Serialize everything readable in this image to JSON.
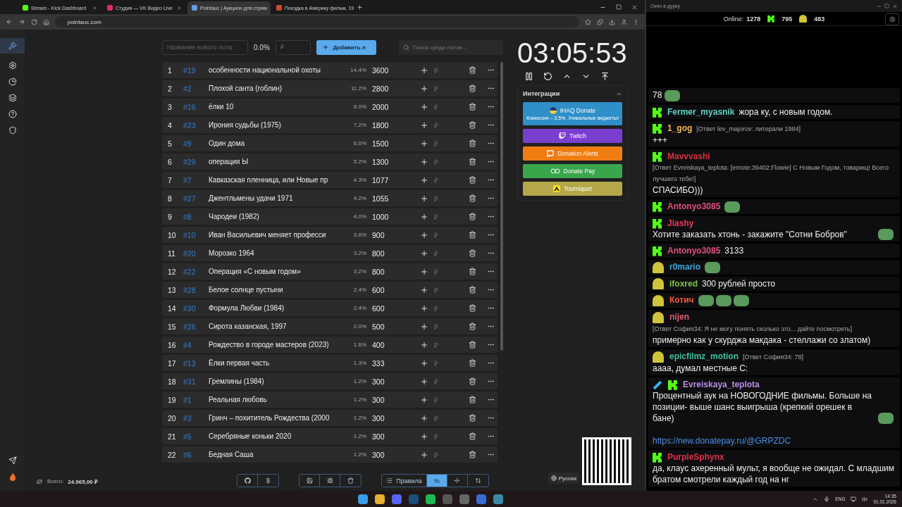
{
  "browser": {
    "tabs": [
      {
        "title": "Stream - Kick Dashboard",
        "selected": false
      },
      {
        "title": "Студия — VK Видео Live",
        "selected": false
      },
      {
        "title": "Pointauc | Аукцион для стрим",
        "selected": true
      },
      {
        "title": "Поездка в Америку фильм, 19",
        "selected": false
      }
    ],
    "url": "pointauc.com"
  },
  "lot_form": {
    "name_placeholder": "Название нового лота",
    "percent": "0.0%",
    "amount_placeholder": "₽",
    "add_button": "Добавить л",
    "search_placeholder": "Поиск среди лотов..."
  },
  "lots": [
    {
      "rank": "1",
      "id": "#19",
      "name": "особенности национальной охоты",
      "percent": "14.4%",
      "amount": "3600",
      "currency": "₽"
    },
    {
      "rank": "2",
      "id": "#2",
      "name": "Плохой санта (гоблин)",
      "percent": "11.2%",
      "amount": "2800",
      "currency": "₽"
    },
    {
      "rank": "3",
      "id": "#16",
      "name": "ёлки 10",
      "percent": "8.0%",
      "amount": "2000",
      "currency": "₽"
    },
    {
      "rank": "4",
      "id": "#23",
      "name": "Ирония судьбы (1975)",
      "percent": "7.2%",
      "amount": "1800",
      "currency": "₽"
    },
    {
      "rank": "5",
      "id": "#9",
      "name": "Один дома",
      "percent": "6.0%",
      "amount": "1500",
      "currency": "₽"
    },
    {
      "rank": "6",
      "id": "#29",
      "name": "операция Ы",
      "percent": "5.2%",
      "amount": "1300",
      "currency": "₽"
    },
    {
      "rank": "7",
      "id": "#7",
      "name": "Кавказская пленница, или Новые пр",
      "percent": "4.3%",
      "amount": "1077",
      "currency": "₽"
    },
    {
      "rank": "8",
      "id": "#27",
      "name": "Джентльмены удачи 1971",
      "percent": "4.2%",
      "amount": "1055",
      "currency": "₽"
    },
    {
      "rank": "9",
      "id": "#8",
      "name": "Чародеи (1982)",
      "percent": "4.0%",
      "amount": "1000",
      "currency": "₽"
    },
    {
      "rank": "10",
      "id": "#10",
      "name": "Иван Васильевич меняет професси",
      "percent": "3.6%",
      "amount": "900",
      "currency": "₽"
    },
    {
      "rank": "11",
      "id": "#20",
      "name": "Морозко 1964",
      "percent": "3.2%",
      "amount": "800",
      "currency": "₽"
    },
    {
      "rank": "12",
      "id": "#22",
      "name": "Операция «С новым годом»",
      "percent": "3.2%",
      "amount": "800",
      "currency": "₽"
    },
    {
      "rank": "13",
      "id": "#28",
      "name": "Белое солнце пустыни",
      "percent": "2.4%",
      "amount": "600",
      "currency": "₽"
    },
    {
      "rank": "14",
      "id": "#30",
      "name": "Формула Любви (1984)",
      "percent": "2.4%",
      "amount": "600",
      "currency": "₽"
    },
    {
      "rank": "15",
      "id": "#26",
      "name": "Сирота казанская, 1997",
      "percent": "2.0%",
      "amount": "500",
      "currency": "₽"
    },
    {
      "rank": "16",
      "id": "#4",
      "name": "Рождество в городе мастеров (2023)",
      "percent": "1.6%",
      "amount": "400",
      "currency": "₽"
    },
    {
      "rank": "17",
      "id": "#13",
      "name": "Ёлки первая часть",
      "percent": "1.3%",
      "amount": "333",
      "currency": "₽"
    },
    {
      "rank": "18",
      "id": "#31",
      "name": "Гремлины (1984)",
      "percent": "1.2%",
      "amount": "300",
      "currency": "₽"
    },
    {
      "rank": "19",
      "id": "#1",
      "name": "Реальная любовь",
      "percent": "1.2%",
      "amount": "300",
      "currency": "₽"
    },
    {
      "rank": "20",
      "id": "#3",
      "name": "Гринч – похититель Рождества (2000",
      "percent": "1.2%",
      "amount": "300",
      "currency": "₽"
    },
    {
      "rank": "21",
      "id": "#5",
      "name": "Серебряные коньки 2020",
      "percent": "1.2%",
      "amount": "300",
      "currency": "₽"
    },
    {
      "rank": "22",
      "id": "#6",
      "name": "Бедная Саша",
      "percent": "1.2%",
      "amount": "300",
      "currency": "₽"
    }
  ],
  "total": {
    "label": "Всего:",
    "value": "24.965,00 ₽"
  },
  "toolbar": [
    [
      {
        "kind": "icon",
        "selected": false
      },
      {
        "kind": "icon",
        "selected": false
      }
    ],
    [
      {
        "kind": "icon",
        "selected": false
      },
      {
        "kind": "icon",
        "selected": false
      },
      {
        "kind": "icon",
        "selected": false
      }
    ],
    [
      {
        "kind": "icon-text",
        "label": "Правила",
        "selected": false
      },
      {
        "kind": "text",
        "label": "%",
        "selected": true
      },
      {
        "kind": "icon",
        "selected": false
      },
      {
        "kind": "icon",
        "selected": false
      }
    ]
  ],
  "timer": "03:05:53",
  "integrations": {
    "title": "Интеграции",
    "expanded": true,
    "items": [
      {
        "kind": "featured",
        "name": "IHAQ Donate",
        "subtitle": "Комиссия – 3,5%. Уникальные виджеты!",
        "color": "#2f8fc8"
      },
      {
        "kind": "twitch",
        "name": "Twitch",
        "color": "#7b3fd0"
      },
      {
        "kind": "donationalerts",
        "name": "Donation Alerts",
        "color": "#f07d12"
      },
      {
        "kind": "donatepay",
        "name": "Donate Pay",
        "color": "#3aa64c"
      },
      {
        "kind": "tourniquet",
        "name": "Tourniquet",
        "color": "#b5a84a"
      }
    ]
  },
  "language": "Русски",
  "chat": {
    "title": "Окно в дурку",
    "online_label": "Online:",
    "online": "1278",
    "kick_count": "795",
    "vk_count": "483",
    "messages": [
      {
        "kind": "plain",
        "moderator": false,
        "text": "78",
        "emotes": [
          {
            "kind": "emote"
          }
        ]
      },
      {
        "kind": "kick",
        "moderator": false,
        "user": "Fermer_myasnik",
        "color": "#5fd3c8",
        "text": "жора ку, с новым годом."
      },
      {
        "kind": "kick",
        "moderator": false,
        "user": "1_gog",
        "color": "#f0b35a",
        "reply": "[Ответ lev_majorov: литерали 1984]",
        "text": "+++"
      },
      {
        "kind": "kick",
        "moderator": false,
        "user": "Mavvvashi",
        "color": "#e0303f",
        "reply": "[Ответ Evreiskaya_teplota: [emote:39402:Flowie] С Новым Годом, товарищ! Всего лучшего тебе!]",
        "text": "СПАСИБО)))"
      },
      {
        "kind": "kick",
        "moderator": false,
        "user": "Antonyo3085",
        "color": "#e0507a",
        "emotes": [
          {
            "kind": "emote"
          }
        ]
      },
      {
        "kind": "kick",
        "moderator": false,
        "user": "Jiashy",
        "color": "#e63d5a",
        "text": "Хотите заказать хтонь - закажите \"Сотни Бобров\"",
        "emotes": [
          {
            "kind": "emote"
          }
        ]
      },
      {
        "kind": "kick",
        "moderator": false,
        "user": "Antonyo3085",
        "color": "#e0507a",
        "text": "3133"
      },
      {
        "kind": "vk",
        "moderator": false,
        "user": "r0mario",
        "color": "#3fa7d6",
        "emotes": [
          {
            "kind": "emote"
          }
        ]
      },
      {
        "kind": "vk",
        "moderator": false,
        "user": "ifoxred",
        "color": "#7bc043",
        "text": "300 рублей просто"
      },
      {
        "kind": "vk",
        "moderator": false,
        "user": "Котич",
        "color": "#f05a3a",
        "emotes": [
          {
            "kind": "emote"
          },
          {
            "kind": "emote"
          },
          {
            "kind": "emote"
          }
        ]
      },
      {
        "kind": "vk",
        "moderator": false,
        "user": "nijen",
        "color": "#e05a70",
        "reply": "[Ответ София34: Я не могу понять сколько это... дайте посмотреть]",
        "text": "примерно как у скурджа макдака - стеллажи со златом)"
      },
      {
        "kind": "vk",
        "moderator": false,
        "user": "epicfilmz_motion",
        "color": "#3fbf9f",
        "reply": "[Ответ София34: 78]",
        "text": "аааа, думал местные С:"
      },
      {
        "kind": "kick",
        "moderator": true,
        "user": "Evreiskaya_teplota",
        "color": "#b98ce8",
        "text": "Процентный аук на НОВОГОДНИЕ фильмы. Больше на позиции- выше шанс выигрыша (крепкий орешек в бане)",
        "emotes": [
          {
            "kind": "emote"
          }
        ],
        "link": "https://new.donatepay.ru/@GRPZDC"
      },
      {
        "kind": "kick",
        "moderator": false,
        "user": "PurpleSphynx",
        "color": "#e0304a",
        "text": "да, клаус ахеренный мульт, я вообще не ожидал. С младшим братом смотрели каждый год на нг"
      }
    ]
  },
  "taskbar": {
    "language": "ENG",
    "time": "14:35",
    "date": "01.01.2026"
  }
}
